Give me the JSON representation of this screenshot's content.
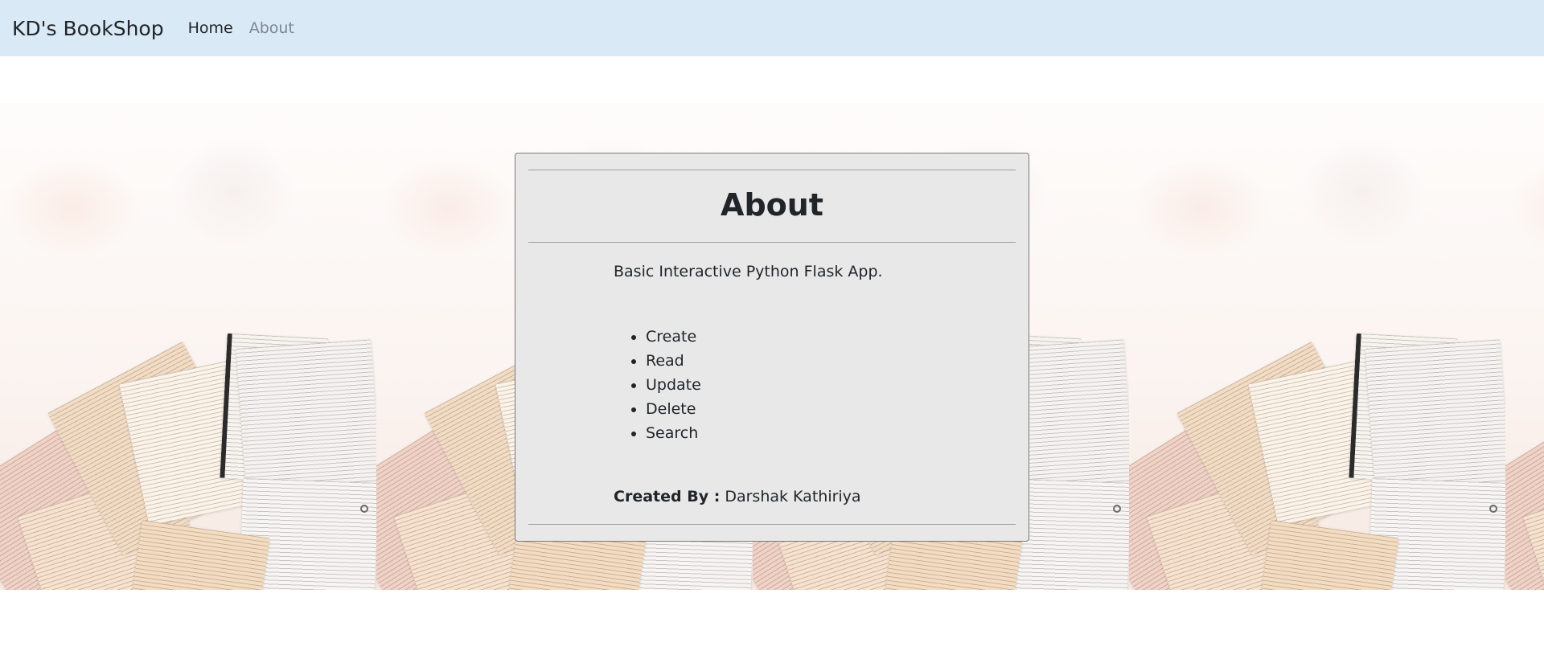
{
  "navbar": {
    "brand": "KD's BookShop",
    "links": [
      {
        "label": "Home",
        "active": true
      },
      {
        "label": "About",
        "active": false
      }
    ]
  },
  "card": {
    "title": "About",
    "description": "Basic Interactive Python Flask App.",
    "features": [
      "Create",
      "Read",
      "Update",
      "Delete",
      "Search"
    ],
    "created_by_label": "Created By :",
    "created_by_name": "Darshak Kathiriya"
  },
  "colors": {
    "navbar_bg": "#d9e9f5",
    "card_bg": "#e8e8e8",
    "text": "#212529",
    "muted_link": "#7d8891"
  },
  "background": {
    "image": "open-books-pattern",
    "tile_count": 5
  }
}
